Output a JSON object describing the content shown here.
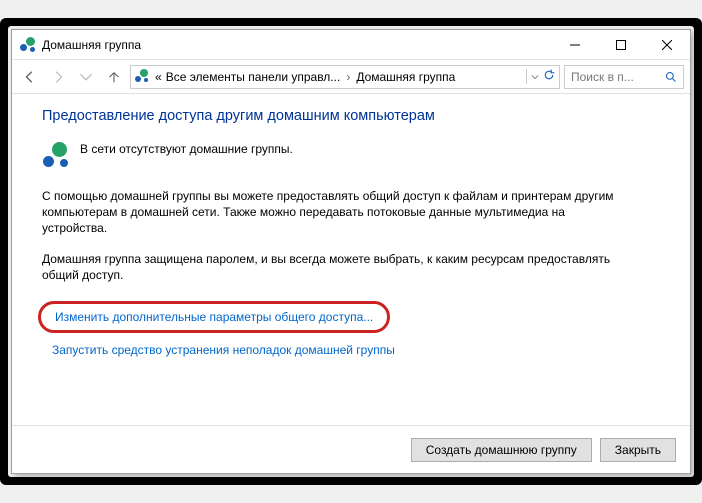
{
  "titlebar": {
    "title": "Домашняя группа"
  },
  "breadcrumb": {
    "seg1": "Все элементы панели управл...",
    "seg2": "Домашняя группа",
    "prefix": "«"
  },
  "search": {
    "placeholder": "Поиск в п..."
  },
  "content": {
    "heading": "Предоставление доступа другим домашним компьютерам",
    "no_groups": "В сети отсутствуют домашние группы.",
    "para1": "С помощью домашней группы вы можете предоставлять общий доступ к файлам и принтерам другим компьютерам в домашней сети. Также можно передавать потоковые данные мультимедиа на устройства.",
    "para2": "Домашняя группа защищена паролем, и вы всегда можете выбрать, к каким ресурсам предоставлять общий доступ.",
    "link1": "Изменить дополнительные параметры общего доступа...",
    "link2": "Запустить средство устранения неполадок домашней группы"
  },
  "footer": {
    "create": "Создать домашнюю группу",
    "close": "Закрыть"
  }
}
